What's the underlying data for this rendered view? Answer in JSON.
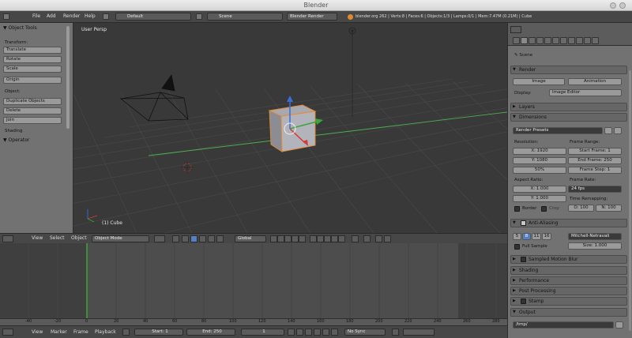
{
  "window": {
    "title": "Blender"
  },
  "info_header": {
    "menus": [
      "File",
      "Add",
      "Render",
      "Help"
    ],
    "screen_layout": "Default",
    "scene": "Scene",
    "render_engine": "Blender Render",
    "status": "blender.org 262 | Verts:8 | Faces:6 | Objects:1/3 | Lamps:0/1 | Mem:7.47M (0.21M) | Cube"
  },
  "toolshelf": {
    "title": "Object Tools",
    "transform_label": "Transform:",
    "transform_buttons": [
      "Translate",
      "Rotate",
      "Scale"
    ],
    "origin_button": "Origin",
    "object_label": "Object:",
    "object_buttons": [
      "Duplicate Objects",
      "Delete",
      "Join"
    ],
    "shading_label": "Shading",
    "operator_label": "Operator"
  },
  "viewport": {
    "title": "User Persp",
    "active_object": "(1) Cube"
  },
  "view3d_header": {
    "menus": [
      "View",
      "Select",
      "Object"
    ],
    "mode": "Object Mode",
    "orientation": "Global"
  },
  "timeline": {
    "ruler_ticks": [
      "-40",
      "-20",
      "0",
      "20",
      "40",
      "60",
      "80",
      "100",
      "120",
      "140",
      "160",
      "180",
      "200",
      "220",
      "240",
      "260",
      "280"
    ],
    "menus": [
      "View",
      "Marker",
      "Frame",
      "Playback"
    ],
    "start": "Start: 1",
    "end": "End: 250",
    "current_frame": "1",
    "sync": "No Sync"
  },
  "properties": {
    "scene_label": "Scene",
    "render_section": "Render",
    "render_image_button": "Image",
    "render_animation_button": "Animation",
    "display_label": "Display:",
    "display_value": "Image Editor",
    "layers_section": "Layers",
    "dimensions_section": "Dimensions",
    "render_presets": "Render Presets",
    "resolution_label": "Resolution:",
    "res_x": "X: 1920",
    "res_y": "Y: 1080",
    "res_percent": "50%",
    "frame_range_label": "Frame Range:",
    "start_frame": "Start Frame: 1",
    "end_frame": "End Frame: 250",
    "frame_step": "Frame Step: 1",
    "aspect_ratio_label": "Aspect Ratio:",
    "aspect_x": "X: 1.000",
    "aspect_y": "Y: 1.000",
    "frame_rate_label": "Frame Rate:",
    "frame_rate_value": "24 fps",
    "time_remap_label": "Time Remapping:",
    "time_old": "O: 100",
    "time_new": "N: 100",
    "border_label": "Border",
    "crop_label": "Crop",
    "antialiasing_section": "Anti-Aliasing",
    "aa_samples": [
      "5",
      "8",
      "11",
      "16"
    ],
    "aa_filter": "Mitchell-Netravali",
    "full_sample_label": "Full Sample",
    "aa_size": "Size: 1.000",
    "sampled_motion_blur_section": "Sampled Motion Blur",
    "shading_section": "Shading",
    "performance_section": "Performance",
    "post_processing_section": "Post Processing",
    "stamp_section": "Stamp",
    "output_section": "Output",
    "output_path": "/tmp/"
  },
  "colors": {
    "accent_blue": "#5680c2",
    "grid_x_axis": "#3aa63a",
    "selection_orange": "#e78a2e"
  }
}
